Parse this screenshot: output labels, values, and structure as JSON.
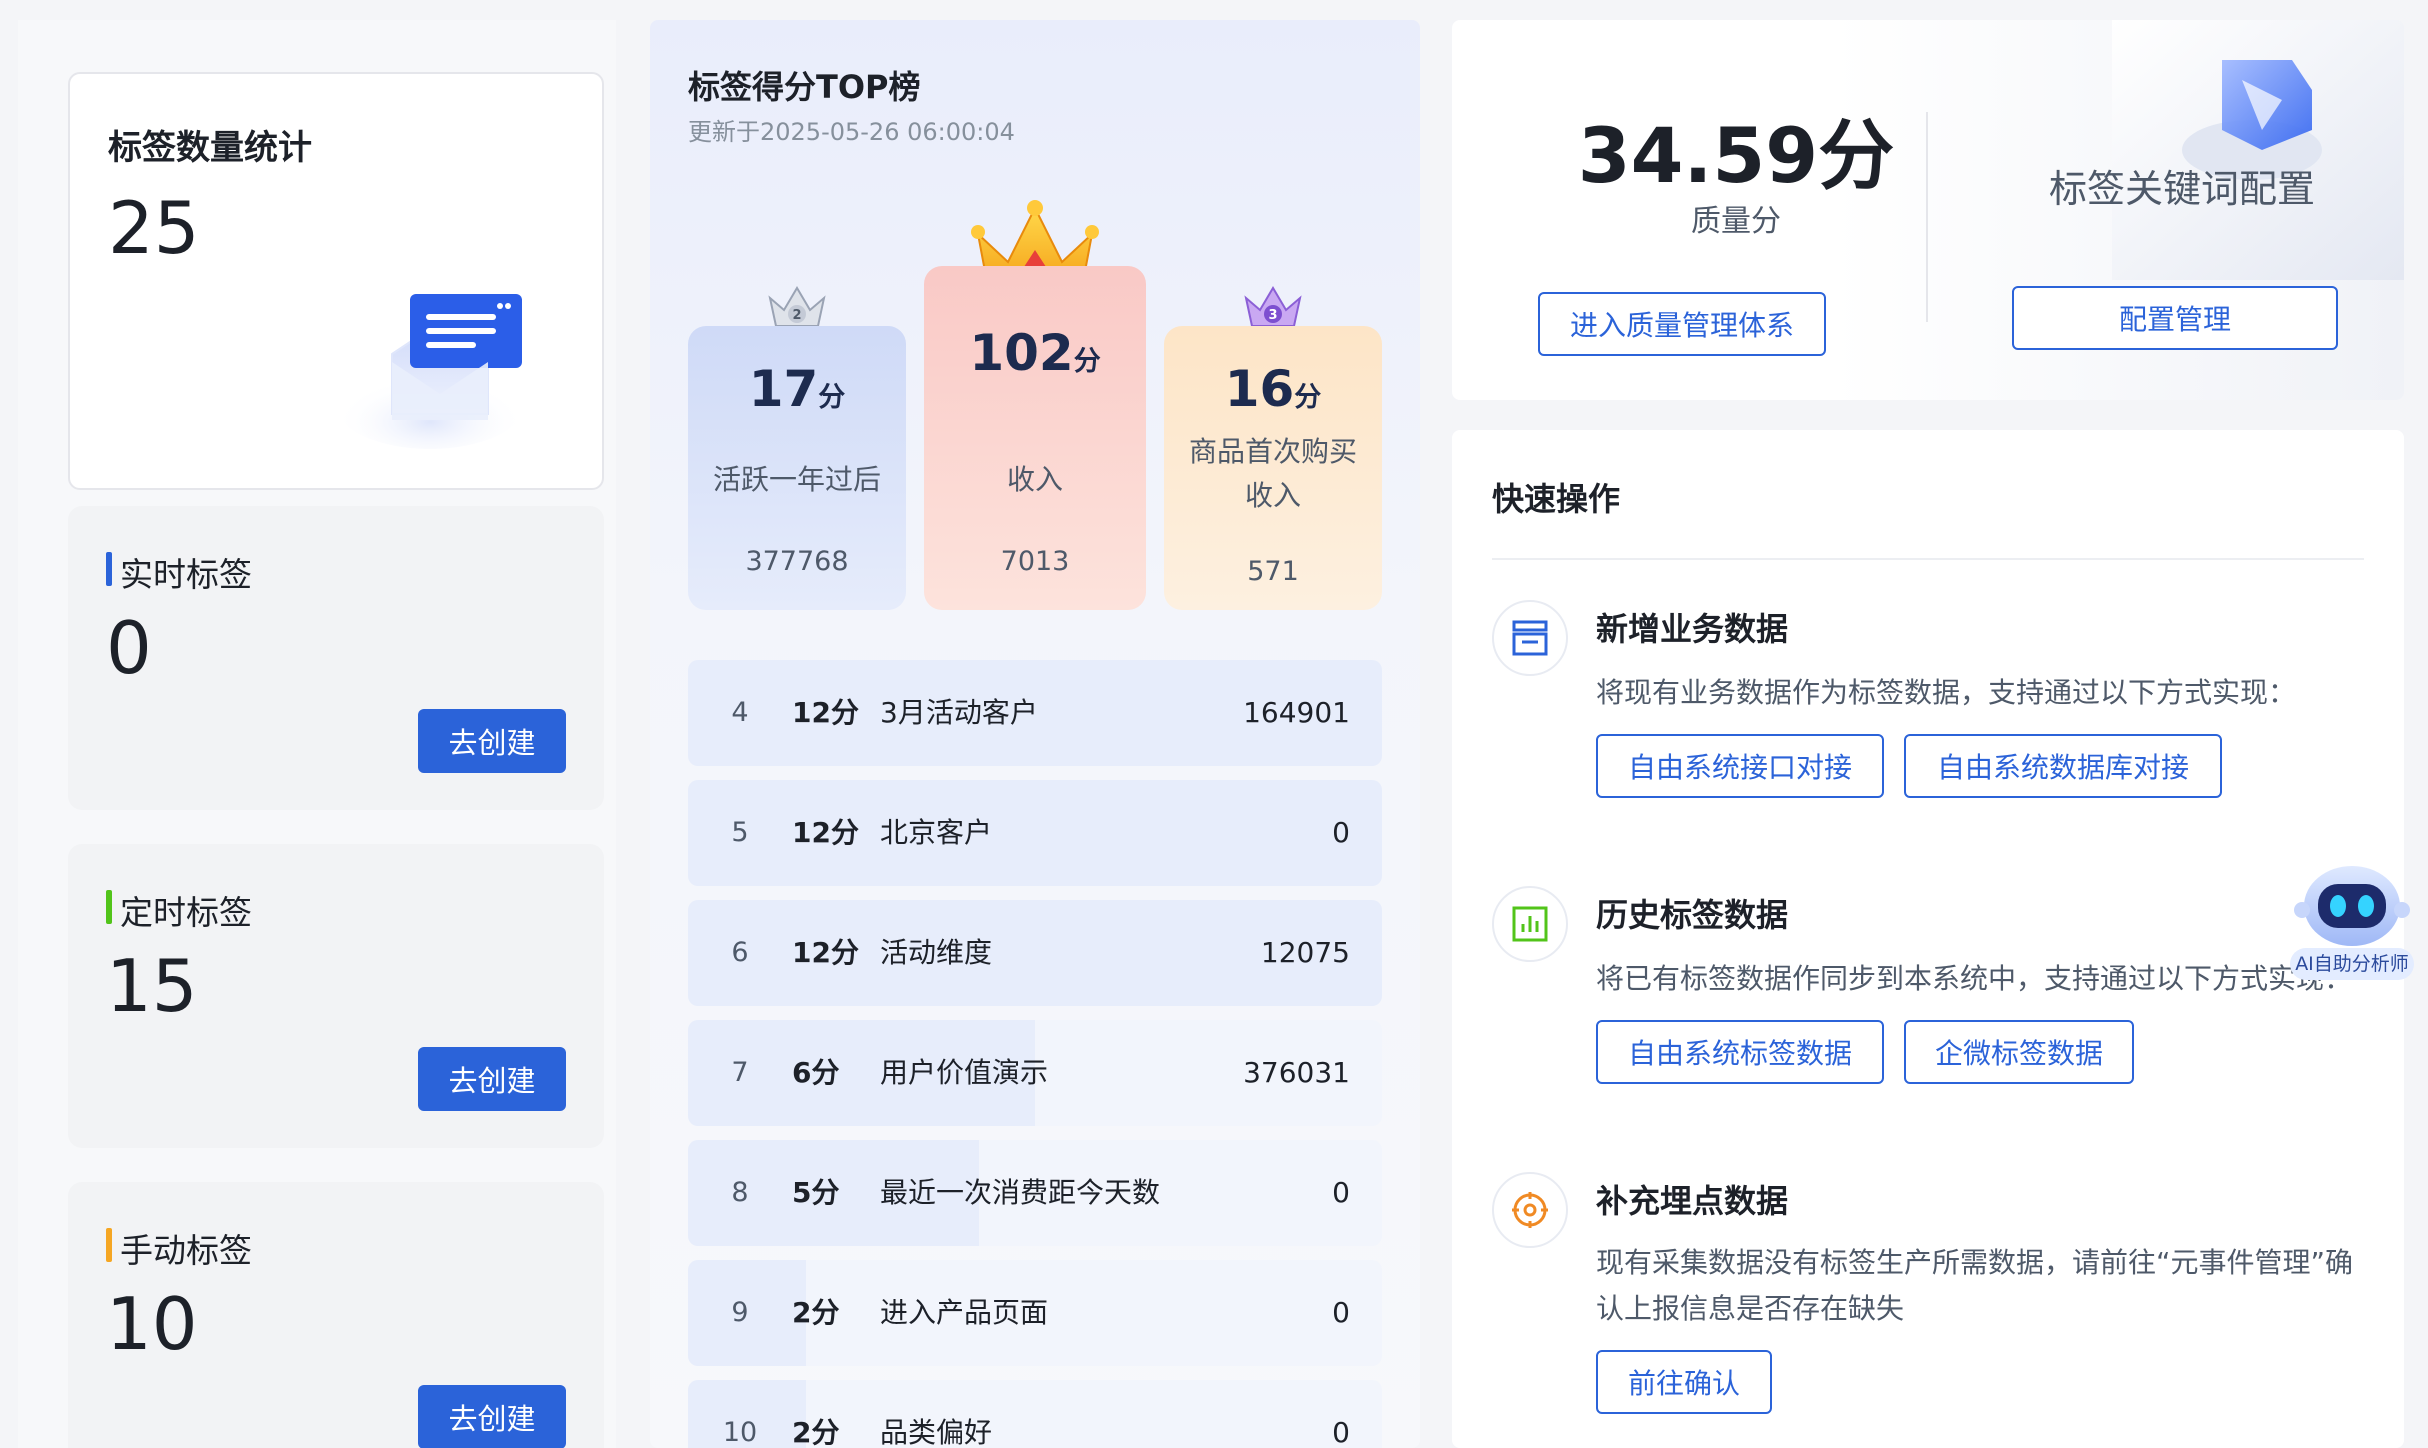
{
  "tag_stats": {
    "title": "标签数量统计",
    "total": "25",
    "types": [
      {
        "label": "实时标签",
        "count": "0",
        "button": "去创建",
        "color": "#2b63d9"
      },
      {
        "label": "定时标签",
        "count": "15",
        "button": "去创建",
        "color": "#52c41a"
      },
      {
        "label": "手动标签",
        "count": "10",
        "button": "去创建",
        "color": "#f5a623"
      }
    ]
  },
  "ranking": {
    "title": "标签得分TOP榜",
    "updated": "更新于2025-05-26 06:00:04",
    "score_unit": "分",
    "top3": [
      {
        "rank": "2",
        "score": "17",
        "name": "活跃一年过后",
        "count": "377768"
      },
      {
        "rank": "1",
        "score": "102",
        "name": "收入",
        "count": "7013"
      },
      {
        "rank": "3",
        "score": "16",
        "name": "商品首次购买收入",
        "count": "571"
      }
    ],
    "rows": [
      {
        "rank": "4",
        "score": "12分",
        "name": "3月活动客户",
        "count": "164901",
        "fill": 1.0
      },
      {
        "rank": "5",
        "score": "12分",
        "name": "北京客户",
        "count": "0",
        "fill": 1.0
      },
      {
        "rank": "6",
        "score": "12分",
        "name": "活动维度",
        "count": "12075",
        "fill": 1.0
      },
      {
        "rank": "7",
        "score": "6分",
        "name": "用户价值演示",
        "count": "376031",
        "fill": 0.5
      },
      {
        "rank": "8",
        "score": "5分",
        "name": "最近一次消费距今天数",
        "count": "0",
        "fill": 0.42
      },
      {
        "rank": "9",
        "score": "2分",
        "name": "进入产品页面",
        "count": "0",
        "fill": 0.17
      },
      {
        "rank": "10",
        "score": "2分",
        "name": "品类偏好",
        "count": "0",
        "fill": 0.17
      }
    ]
  },
  "quality": {
    "score": "34.59分",
    "label": "质量分",
    "button": "进入质量管理体系",
    "keyword_title": "标签关键词配置",
    "keyword_button": "配置管理"
  },
  "quick_actions": {
    "title": "快速操作",
    "items": [
      {
        "title": "新增业务数据",
        "desc": "将现有业务数据作为标签数据，支持通过以下方式实现：",
        "buttons": [
          "自由系统接口对接",
          "自由系统数据库对接"
        ]
      },
      {
        "title": "历史标签数据",
        "desc": "将已有标签数据作同步到本系统中，支持通过以下方式实现：",
        "buttons": [
          "自由系统标签数据",
          "企微标签数据"
        ]
      },
      {
        "title": "补充埋点数据",
        "desc": "现有采集数据没有标签生产所需数据，请前往“元事件管理”确认上报信息是否存在缺失",
        "buttons": [
          "前往确认"
        ]
      }
    ]
  },
  "assistant": {
    "label": "AI自助分析师"
  }
}
